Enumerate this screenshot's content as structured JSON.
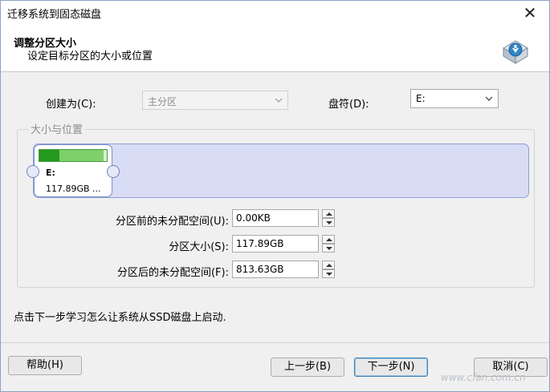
{
  "window": {
    "title": "迁移系统到固态磁盘",
    "close_glyph": "✕"
  },
  "header": {
    "title": "调整分区大小",
    "subtitle": "设定目标分区的大小或位置",
    "icon": "disk-migrate-icon"
  },
  "form": {
    "create_as_label": "创建为(C):",
    "create_as_value": "主分区",
    "drive_letter_label": "盘符(D):",
    "drive_letter_value": "E:"
  },
  "size_position": {
    "legend": "大小与位置",
    "partition": {
      "letter": "E:",
      "size_text": "117.89GB ...",
      "fill_fraction": 0.95,
      "used_fraction": 0.3
    },
    "fields": [
      {
        "label": "分区前的未分配空间(U):",
        "value": "0.00KB"
      },
      {
        "label": "分区大小(S):",
        "value": "117.89GB"
      },
      {
        "label": "分区后的未分配空间(F):",
        "value": "813.63GB"
      }
    ]
  },
  "hint": "点击下一步学习怎么让系统从SSD磁盘上启动.",
  "buttons": {
    "help": "帮助(H)",
    "back": "上一步(B)",
    "next": "下一步(N)",
    "cancel": "取消(C)"
  },
  "watermark": "www.cfan.com.cn",
  "colors": {
    "disk_bar": "#d8dcf4",
    "partition_fill": "#7ed06a",
    "partition_used": "#249a1e"
  }
}
